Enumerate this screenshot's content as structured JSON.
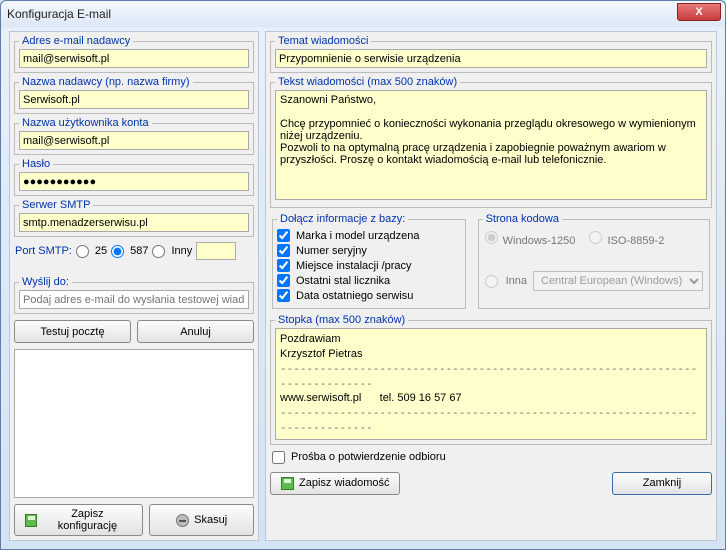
{
  "window": {
    "title": "Konfiguracja E-mail",
    "close_glyph": "X"
  },
  "left": {
    "sender_email": {
      "legend": "Adres e-mail nadawcy",
      "value": "mail@serwisoft.pl"
    },
    "sender_name": {
      "legend": "Nazwa nadawcy (np. nazwa firmy)",
      "value": "Serwisoft.pl"
    },
    "username": {
      "legend": "Nazwa użytkownika konta",
      "value": "mail@serwisoft.pl"
    },
    "password": {
      "legend": "Hasło",
      "value": "●●●●●●●●●●●"
    },
    "smtp": {
      "legend": "Serwer SMTP",
      "value": "smtp.menadzerserwisu.pl"
    },
    "port": {
      "label": "Port SMTP:",
      "opts": {
        "p25": "25",
        "p587": "587",
        "other": "Inny"
      },
      "other_value": ""
    },
    "sendto": {
      "legend": "Wyślij do:",
      "placeholder": "Podaj adres e-mail do wysłania testowej wiadomości"
    },
    "buttons": {
      "test": "Testuj pocztę",
      "cancel": "Anuluj",
      "save": "Zapisz konfigurację",
      "discard": "Skasuj"
    }
  },
  "right": {
    "subject": {
      "legend": "Temat wiadomości",
      "value": "Przypomnienie o serwisie urządzenia"
    },
    "body": {
      "legend": "Tekst wiadomości (max 500 znaków)",
      "value": "Szanowni Państwo,\n\nChcę przypomnieć o konieczności wykonania przeglądu okresowego w wymienionym niżej urządzeniu.\nPozwoli to na optymalną pracę urządzenia i zapobiegnie poważnym awariom w przyszłości. Proszę o kontakt wiadomością e-mail lub telefonicznie."
    },
    "include": {
      "legend": "Dołącz informacje z bazy:",
      "items": [
        {
          "label": "Marka i model urządzena",
          "checked": true
        },
        {
          "label": "Numer seryjny",
          "checked": true
        },
        {
          "label": "Miejsce instalacji /pracy",
          "checked": true
        },
        {
          "label": "Ostatni stal licznika",
          "checked": true
        },
        {
          "label": "Data ostatniego serwisu",
          "checked": true
        }
      ]
    },
    "codepage": {
      "legend": "Strona kodowa",
      "opts": {
        "win1250": "Windows-1250",
        "iso": "ISO-8859-2",
        "other": "Inna"
      },
      "combo": "Central European (Windows)"
    },
    "footer": {
      "legend": "Stopka (max 500 znaków)",
      "lines": {
        "l1": "Pozdrawiam",
        "l2": "Krzysztof Pietras",
        "dash": "-----------------------------------------------------------------------------",
        "l3": "www.serwisoft.pl      tel. 509 16 57 67",
        "dash2": "-----------------------------------------------------------------------------"
      }
    },
    "confirm_label": "Prośba o potwierdzenie odbioru",
    "buttons": {
      "save_msg": "Zapisz wiadomość",
      "close": "Zamknij"
    }
  }
}
